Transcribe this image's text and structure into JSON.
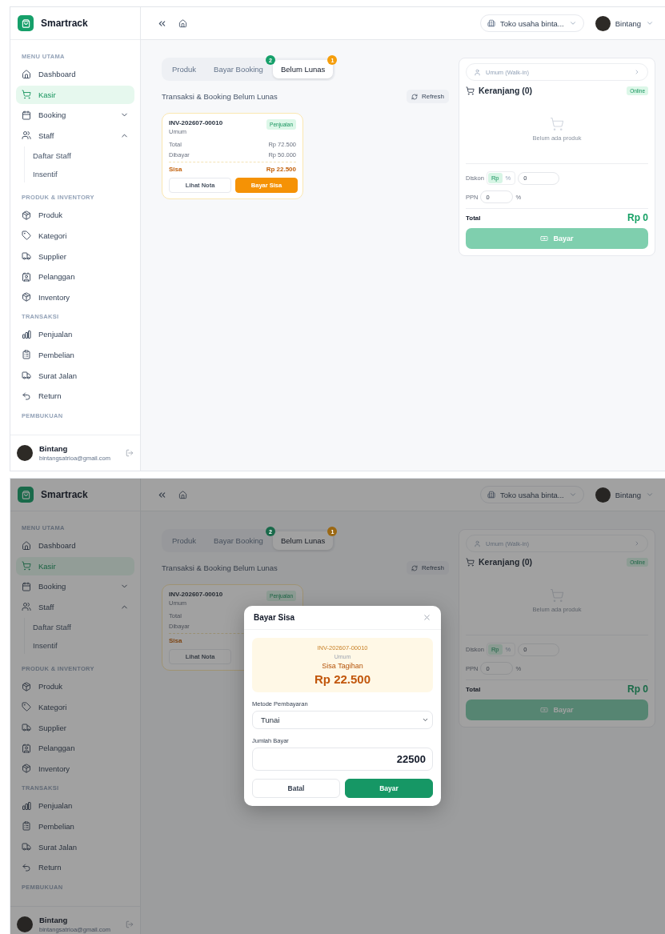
{
  "screens": [
    {
      "brand": "Smartrack",
      "header": {
        "store": "Toko usaha binta...",
        "user": "Bintang"
      },
      "sidebar": {
        "sections": [
          {
            "title": "MENU UTAMA",
            "items": [
              {
                "label": "Dashboard",
                "selected": false
              },
              {
                "label": "Kasir",
                "selected": true
              },
              {
                "label": "Booking",
                "selected": false,
                "expanded": false
              },
              {
                "label": "Staff",
                "selected": false,
                "expanded": true,
                "children": [
                  {
                    "label": "Daftar Staff"
                  },
                  {
                    "label": "Insentif"
                  }
                ]
              }
            ]
          },
          {
            "title": "PRODUK & INVENTORY",
            "items": [
              {
                "label": "Produk",
                "selected": false
              },
              {
                "label": "Kategori",
                "selected": false
              },
              {
                "label": "Supplier",
                "selected": false
              },
              {
                "label": "Pelanggan",
                "selected": false
              },
              {
                "label": "Inventory",
                "selected": false
              }
            ]
          },
          {
            "title": "TRANSAKSI",
            "items": [
              {
                "label": "Penjualan",
                "selected": false
              },
              {
                "label": "Pembelian",
                "selected": false
              },
              {
                "label": "Surat Jalan",
                "selected": false
              },
              {
                "label": "Return",
                "selected": false
              }
            ]
          },
          {
            "title": "PEMBUKUAN"
          }
        ],
        "user": {
          "name": "Bintang",
          "email": "bintangsatrioa@gmail.com"
        }
      },
      "tabs": [
        {
          "label": "Produk",
          "selected": false
        },
        {
          "label": "Bayar Booking",
          "selected": false,
          "badge": "2",
          "color": "#16a06a"
        },
        {
          "label": "Belum Lunas",
          "selected": true,
          "badge": "1",
          "color": "#f59e0b"
        }
      ],
      "list": {
        "title": "Transaksi & Booking Belum Lunas",
        "refresh": "Refresh",
        "cards": [
          {
            "invoice": "INV-202607-00010",
            "customer": "Umum",
            "tag": "Penjualan",
            "rows": [
              {
                "label": "Total",
                "value": "Rp 72.500"
              },
              {
                "label": "Dibayar",
                "value": "Rp 50.000"
              }
            ],
            "remaining": {
              "label": "Sisa",
              "value": "Rp 22.500"
            },
            "actions": [
              "Lihat Nota",
              "Bayar Sisa"
            ]
          }
        ]
      },
      "cart": {
        "customer": "Umum (Walk-in)",
        "title": "Keranjang (0)",
        "status": "Online",
        "empty": "Belum ada produk",
        "discount": {
          "label": "Diskon",
          "modes": [
            {
              "label": "Rp",
              "selected": true
            },
            {
              "label": "%",
              "selected": false
            }
          ],
          "value": "0"
        },
        "tax": {
          "label": "PPN",
          "value": "0",
          "unit": "%"
        },
        "total": {
          "label": "Total",
          "value": "Rp 0"
        },
        "pay_button": {
          "label": "Bayar",
          "disabled": true
        }
      }
    },
    {
      "brand": "Smartrack",
      "header": {
        "store": "Toko usaha binta...",
        "user": "Bintang"
      },
      "sidebar": {
        "sections": [
          {
            "title": "MENU UTAMA",
            "items": [
              {
                "label": "Dashboard",
                "selected": false
              },
              {
                "label": "Kasir",
                "selected": true
              },
              {
                "label": "Booking",
                "selected": false,
                "expanded": false
              },
              {
                "label": "Staff",
                "selected": false,
                "expanded": true,
                "children": [
                  {
                    "label": "Daftar Staff"
                  },
                  {
                    "label": "Insentif"
                  }
                ]
              }
            ]
          },
          {
            "title": "PRODUK & INVENTORY",
            "items": [
              {
                "label": "Produk",
                "selected": false
              },
              {
                "label": "Kategori",
                "selected": false
              },
              {
                "label": "Supplier",
                "selected": false
              },
              {
                "label": "Pelanggan",
                "selected": false
              },
              {
                "label": "Inventory",
                "selected": false
              }
            ]
          },
          {
            "title": "TRANSAKSI",
            "items": [
              {
                "label": "Penjualan",
                "selected": false
              },
              {
                "label": "Pembelian",
                "selected": false
              },
              {
                "label": "Surat Jalan",
                "selected": false
              },
              {
                "label": "Return",
                "selected": false
              }
            ]
          },
          {
            "title": "PEMBUKUAN"
          }
        ],
        "user": {
          "name": "Bintang",
          "email": "bintangsatrioa@gmail.com"
        }
      },
      "tabs": [
        {
          "label": "Produk",
          "selected": false
        },
        {
          "label": "Bayar Booking",
          "selected": false,
          "badge": "2",
          "color": "#19694a"
        },
        {
          "label": "Belum Lunas",
          "selected": true,
          "badge": "1",
          "color": "#9b6813"
        }
      ],
      "list": {
        "title": "Transaksi & Booking Belum Lunas",
        "refresh": "Refresh",
        "cards": [
          {
            "invoice": "INV-202607-00010",
            "customer": "Umum",
            "tag": "Penjualan",
            "rows": [
              {
                "label": "Total"
              },
              {
                "label": "Dibayar"
              }
            ],
            "remaining": {
              "label": "Sisa"
            },
            "actions": [
              "Lihat Nota"
            ]
          }
        ]
      },
      "cart": {
        "customer": "Umum (Walk-in)",
        "title": "Keranjang (0)",
        "status": "Online",
        "empty": "Belum ada produk",
        "discount": {
          "label": "Diskon",
          "modes": [
            {
              "label": "Rp",
              "selected": true
            },
            {
              "label": "%",
              "selected": false
            }
          ],
          "value": "0"
        },
        "tax": {
          "label": "PPN",
          "value": "0",
          "unit": "%"
        },
        "total": {
          "label": "Total",
          "value": "Rp 0"
        },
        "pay_button": {
          "label": "Bayar",
          "disabled": true
        }
      },
      "modal": {
        "title": "Bayar Sisa",
        "invoice": "INV-202607-00010",
        "customer": "Umum",
        "amount_label": "Sisa Tagihan",
        "amount": "Rp 22.500",
        "method": {
          "label": "Metode Pembayaran",
          "value": "Tunai"
        },
        "pay_amount": {
          "label": "Jumlah Bayar",
          "value": "22500"
        },
        "buttons": [
          {
            "label": "Batal",
            "kind": "secondary"
          },
          {
            "label": "Bayar",
            "kind": "primary"
          }
        ]
      }
    }
  ]
}
